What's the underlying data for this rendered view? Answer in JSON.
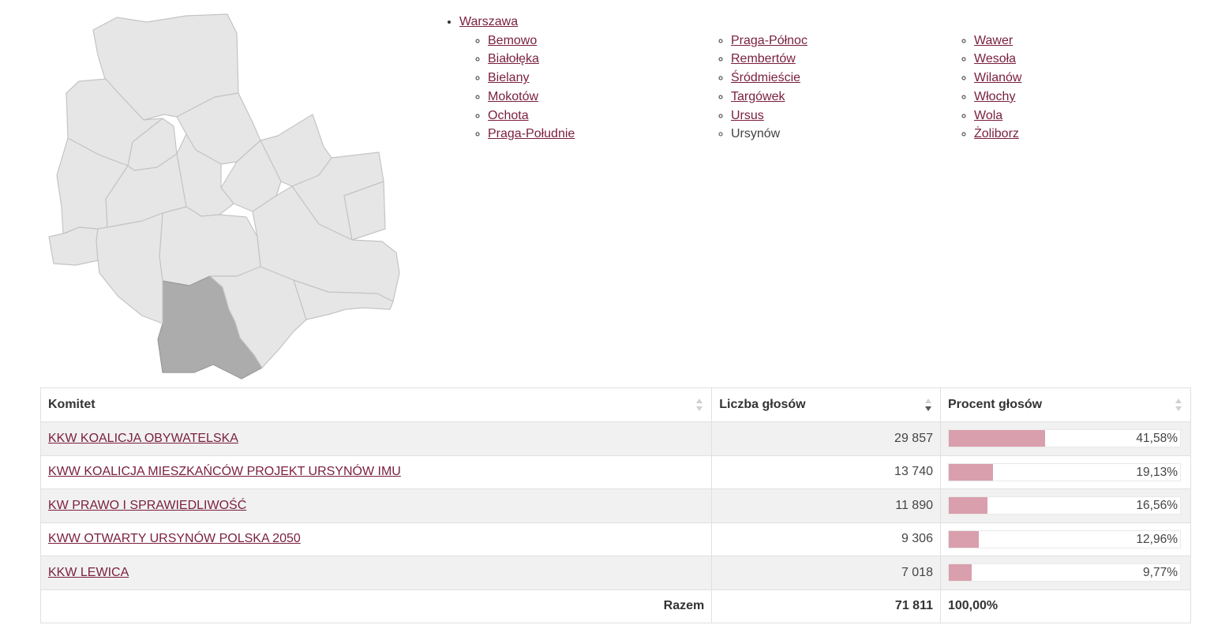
{
  "nav": {
    "root": "Warszawa",
    "columns": [
      [
        {
          "label": "Bemowo",
          "link": true
        },
        {
          "label": "Białołęka",
          "link": true
        },
        {
          "label": "Bielany",
          "link": true
        },
        {
          "label": "Mokotów",
          "link": true
        },
        {
          "label": "Ochota",
          "link": true
        },
        {
          "label": "Praga-Południe",
          "link": true
        }
      ],
      [
        {
          "label": "Praga-Północ",
          "link": true
        },
        {
          "label": "Rembertów",
          "link": true
        },
        {
          "label": "Śródmieście",
          "link": true
        },
        {
          "label": "Targówek",
          "link": true
        },
        {
          "label": "Ursus",
          "link": true
        },
        {
          "label": "Ursynów",
          "link": false
        }
      ],
      [
        {
          "label": "Wawer",
          "link": true
        },
        {
          "label": "Wesoła",
          "link": true
        },
        {
          "label": "Wilanów",
          "link": true
        },
        {
          "label": "Włochy",
          "link": true
        },
        {
          "label": "Wola",
          "link": true
        },
        {
          "label": "Żoliborz",
          "link": true
        }
      ]
    ]
  },
  "map": {
    "selected_district": "Ursynów",
    "colors": {
      "district": "#e6e6e6",
      "selected": "#acacac",
      "border": "#c4c4c4"
    }
  },
  "table": {
    "headers": {
      "committee": "Komitet",
      "votes": "Liczba głosów",
      "percent": "Procent głosów"
    },
    "rows": [
      {
        "committee": "KKW KOALICJA OBYWATELSKA",
        "votes": "29 857",
        "percent": "41,58%",
        "share": 0.4158
      },
      {
        "committee": "KWW KOALICJA MIESZKAŃCÓW PROJEKT URSYNÓW IMU",
        "votes": "13 740",
        "percent": "19,13%",
        "share": 0.1913
      },
      {
        "committee": "KW PRAWO I SPRAWIEDLIWOŚĆ",
        "votes": "11 890",
        "percent": "16,56%",
        "share": 0.1656
      },
      {
        "committee": "KWW OTWARTY URSYNÓW POLSKA 2050",
        "votes": "9 306",
        "percent": "12,96%",
        "share": 0.1296
      },
      {
        "committee": "KKW LEWICA",
        "votes": "7 018",
        "percent": "9,77%",
        "share": 0.0977
      }
    ],
    "total": {
      "label": "Razem",
      "votes": "71 811",
      "percent": "100,00%"
    },
    "colors": {
      "bar_fill": "#d99fac",
      "link": "#7a1f3d",
      "row_shade": "#f1f1f1"
    },
    "sort": {
      "active_column": "votes",
      "direction": "descending"
    }
  }
}
